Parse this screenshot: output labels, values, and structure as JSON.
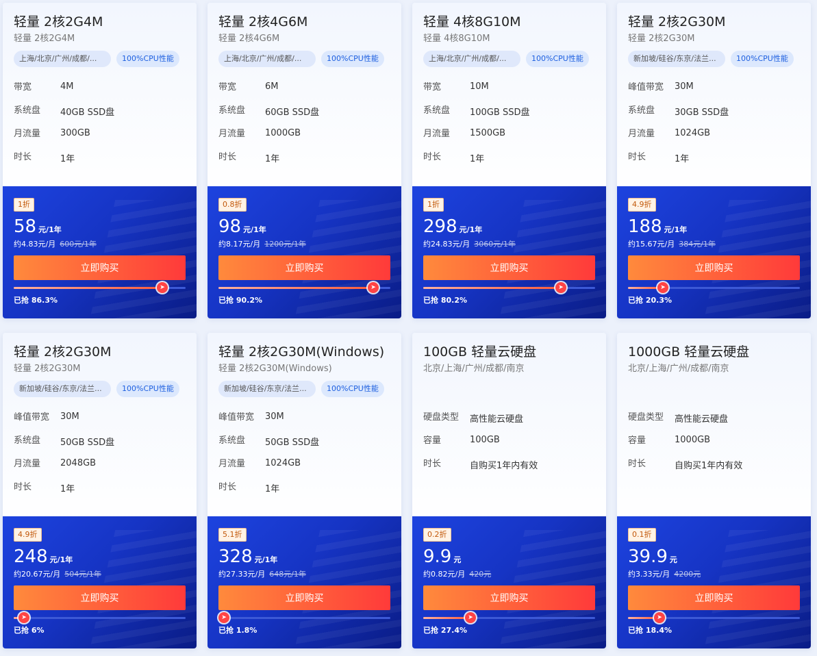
{
  "products": [
    {
      "title": "轻量 2核2G4M",
      "subtitle": "轻量 2核2G4M",
      "tags": [
        "上海/北京/广州/成都/...",
        "100%CPU性能"
      ],
      "specs": [
        [
          "带宽",
          "4M"
        ],
        [
          "系统盘",
          "40GB SSD盘"
        ],
        [
          "月流量",
          "300GB"
        ],
        [
          "时长",
          "1年"
        ]
      ],
      "discount": "1折",
      "price": "58",
      "unit": "元/1年",
      "monthly": "约4.83元/月",
      "original": "600元/1年",
      "buy_label": "立即购买",
      "sold_fraction": 0.863,
      "sold_text": "已抢 86.3%"
    },
    {
      "title": "轻量 2核4G6M",
      "subtitle": "轻量 2核4G6M",
      "tags": [
        "上海/北京/广州/成都/...",
        "100%CPU性能"
      ],
      "specs": [
        [
          "带宽",
          "6M"
        ],
        [
          "系统盘",
          "60GB SSD盘"
        ],
        [
          "月流量",
          "1000GB"
        ],
        [
          "时长",
          "1年"
        ]
      ],
      "discount": "0.8折",
      "price": "98",
      "unit": "元/1年",
      "monthly": "约8.17元/月",
      "original": "1200元/1年",
      "buy_label": "立即购买",
      "sold_fraction": 0.902,
      "sold_text": "已抢 90.2%"
    },
    {
      "title": "轻量 4核8G10M",
      "subtitle": "轻量 4核8G10M",
      "tags": [
        "上海/北京/广州/成都/...",
        "100%CPU性能"
      ],
      "specs": [
        [
          "带宽",
          "10M"
        ],
        [
          "系统盘",
          "100GB SSD盘"
        ],
        [
          "月流量",
          "1500GB"
        ],
        [
          "时长",
          "1年"
        ]
      ],
      "discount": "1折",
      "price": "298",
      "unit": "元/1年",
      "monthly": "约24.83元/月",
      "original": "3060元/1年",
      "buy_label": "立即购买",
      "sold_fraction": 0.802,
      "sold_text": "已抢 80.2%"
    },
    {
      "title": "轻量 2核2G30M",
      "subtitle": "轻量 2核2G30M",
      "tags": [
        "新加坡/硅谷/东京/法兰...",
        "100%CPU性能"
      ],
      "specs": [
        [
          "峰值带宽",
          "30M"
        ],
        [
          "系统盘",
          "30GB SSD盘"
        ],
        [
          "月流量",
          "1024GB"
        ],
        [
          "时长",
          "1年"
        ]
      ],
      "discount": "4.9折",
      "price": "188",
      "unit": "元/1年",
      "monthly": "约15.67元/月",
      "original": "384元/1年",
      "buy_label": "立即购买",
      "sold_fraction": 0.203,
      "sold_text": "已抢 20.3%"
    },
    {
      "title": "轻量 2核2G30M",
      "subtitle": "轻量 2核2G30M",
      "tags": [
        "新加坡/硅谷/东京/法兰...",
        "100%CPU性能"
      ],
      "specs": [
        [
          "峰值带宽",
          "30M"
        ],
        [
          "系统盘",
          "50GB SSD盘"
        ],
        [
          "月流量",
          "2048GB"
        ],
        [
          "时长",
          "1年"
        ]
      ],
      "discount": "4.9折",
      "price": "248",
      "unit": "元/1年",
      "monthly": "约20.67元/月",
      "original": "504元/1年",
      "buy_label": "立即购买",
      "sold_fraction": 0.06,
      "sold_text": "已抢 6%"
    },
    {
      "title": "轻量 2核2G30M(Windows)",
      "subtitle": "轻量 2核2G30M(Windows)",
      "tags": [
        "新加坡/硅谷/东京/法兰...",
        "100%CPU性能"
      ],
      "specs": [
        [
          "峰值带宽",
          "30M"
        ],
        [
          "系统盘",
          "50GB SSD盘"
        ],
        [
          "月流量",
          "1024GB"
        ],
        [
          "时长",
          "1年"
        ]
      ],
      "discount": "5.1折",
      "price": "328",
      "unit": "元/1年",
      "monthly": "约27.33元/月",
      "original": "648元/1年",
      "buy_label": "立即购买",
      "sold_fraction": 0.018,
      "sold_text": "已抢 1.8%"
    },
    {
      "title": "100GB 轻量云硬盘",
      "subtitle": "北京/上海/广州/成都/南京",
      "tags": [],
      "specs": [
        [
          "硬盘类型",
          "高性能云硬盘"
        ],
        [
          "容量",
          "100GB"
        ],
        [
          "时长",
          "自购买1年内有效"
        ]
      ],
      "discount": "0.2折",
      "price": "9.9",
      "unit": "元",
      "monthly": "约0.82元/月",
      "original": "420元",
      "buy_label": "立即购买",
      "sold_fraction": 0.274,
      "sold_text": "已抢 27.4%"
    },
    {
      "title": "1000GB 轻量云硬盘",
      "subtitle": "北京/上海/广州/成都/南京",
      "tags": [],
      "specs": [
        [
          "硬盘类型",
          "高性能云硬盘"
        ],
        [
          "容量",
          "1000GB"
        ],
        [
          "时长",
          "自购买1年内有效"
        ]
      ],
      "discount": "0.1折",
      "price": "39.9",
      "unit": "元",
      "monthly": "约3.33元/月",
      "original": "4200元",
      "buy_label": "立即购买",
      "sold_fraction": 0.184,
      "sold_text": "已抢 18.4%"
    }
  ],
  "icons": {
    "progress_marker": "rocket-icon"
  }
}
